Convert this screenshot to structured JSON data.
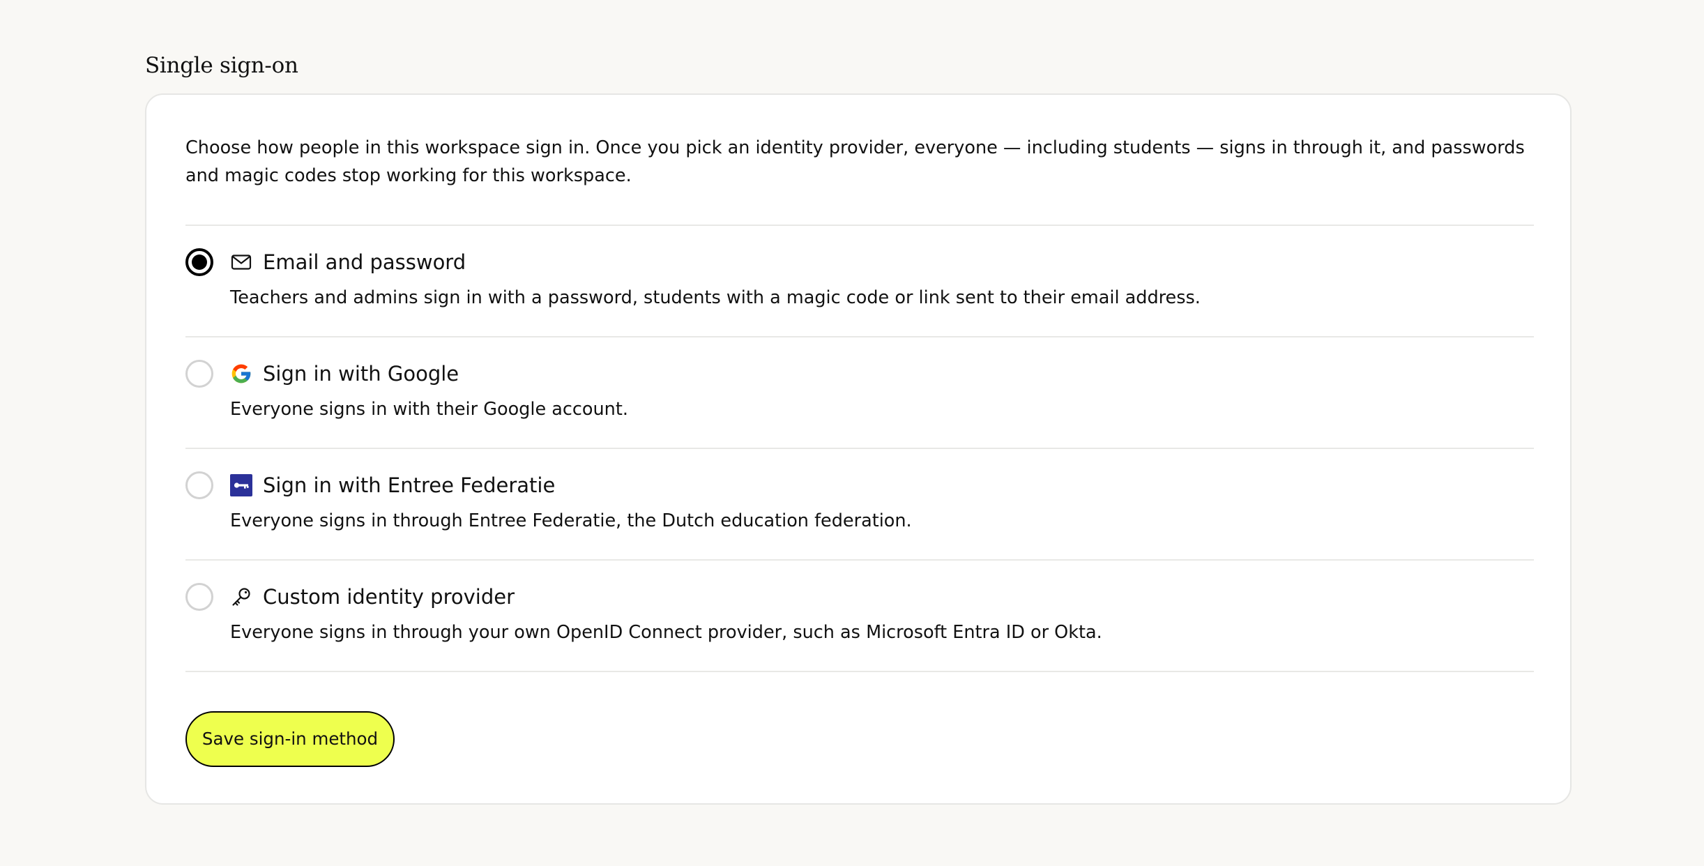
{
  "section": {
    "title": "Single sign-on"
  },
  "card": {
    "intro": "Choose how people in this workspace sign in. Once you pick an identity provider, everyone — including students — signs in through it, and passwords and magic codes stop working for this workspace.",
    "options": [
      {
        "icon": "mail-icon",
        "title": "Email and password",
        "description": "Teachers and admins sign in with a password, students with a magic code or link sent to their email address.",
        "selected": true
      },
      {
        "icon": "google-icon",
        "title": "Sign in with Google",
        "description": "Everyone signs in with their Google account.",
        "selected": false
      },
      {
        "icon": "entree-federatie-key-icon",
        "title": "Sign in with Entree Federatie",
        "description": "Everyone signs in through Entree Federatie, the Dutch education federation.",
        "selected": false
      },
      {
        "icon": "key-icon",
        "title": "Custom identity provider",
        "description": "Everyone signs in through your own OpenID Connect provider, such as Microsoft Entra ID or Okta.",
        "selected": false
      }
    ],
    "save_label": "Save sign-in method"
  },
  "colors": {
    "page_background": "#f9f8f5",
    "card_background": "#ffffff",
    "accent_button": "#eeff4e",
    "entree_brand": "#2b3199",
    "google_blue": "#4285F4",
    "google_green": "#34A853",
    "google_yellow": "#FBBC05",
    "google_red": "#EA4335"
  }
}
